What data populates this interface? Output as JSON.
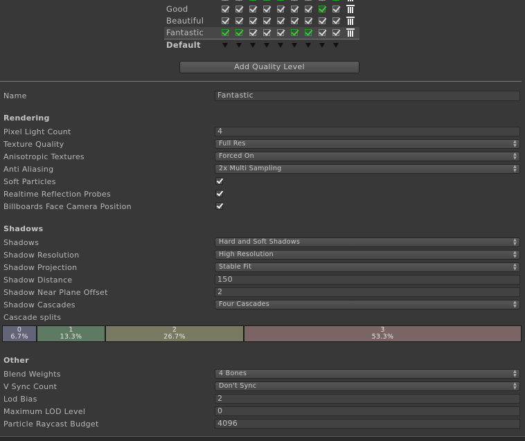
{
  "quality_levels": {
    "rows": [
      {
        "name": "",
        "checks": [
          false,
          false,
          true,
          true,
          true,
          false,
          false,
          false,
          true
        ],
        "partial": true
      },
      {
        "name": "Good",
        "checks": [
          false,
          false,
          false,
          false,
          false,
          false,
          false,
          true,
          false
        ]
      },
      {
        "name": "Beautiful",
        "checks": [
          false,
          false,
          false,
          false,
          false,
          false,
          false,
          false,
          false
        ]
      },
      {
        "name": "Fantastic",
        "checks": [
          true,
          true,
          false,
          false,
          false,
          true,
          true,
          false,
          false
        ],
        "selected": true
      }
    ],
    "default_label": "Default",
    "add_button": "Add Quality Level"
  },
  "name": {
    "label": "Name",
    "value": "Fantastic"
  },
  "rendering": {
    "header": "Rendering",
    "pixel_light_count": {
      "label": "Pixel Light Count",
      "value": "4"
    },
    "texture_quality": {
      "label": "Texture Quality",
      "value": "Full Res"
    },
    "anisotropic_textures": {
      "label": "Anisotropic Textures",
      "value": "Forced On"
    },
    "anti_aliasing": {
      "label": "Anti Aliasing",
      "value": "2x Multi Sampling"
    },
    "soft_particles": {
      "label": "Soft Particles",
      "checked": true
    },
    "realtime_reflection_probes": {
      "label": "Realtime Reflection Probes",
      "checked": true
    },
    "billboards_face_camera": {
      "label": "Billboards Face Camera Position",
      "checked": true
    }
  },
  "shadows": {
    "header": "Shadows",
    "shadows": {
      "label": "Shadows",
      "value": "Hard and Soft Shadows"
    },
    "shadow_resolution": {
      "label": "Shadow Resolution",
      "value": "High Resolution"
    },
    "shadow_projection": {
      "label": "Shadow Projection",
      "value": "Stable Fit"
    },
    "shadow_distance": {
      "label": "Shadow Distance",
      "value": "150"
    },
    "shadow_near_plane_offset": {
      "label": "Shadow Near Plane Offset",
      "value": "2"
    },
    "shadow_cascades": {
      "label": "Shadow Cascades",
      "value": "Four Cascades"
    },
    "cascade_splits": {
      "label": "Cascade splits",
      "segments": [
        {
          "index": "0",
          "percent": "6.7%",
          "fraction": 0.067,
          "color": "#626478"
        },
        {
          "index": "1",
          "percent": "13.3%",
          "fraction": 0.133,
          "color": "#5f7a62"
        },
        {
          "index": "2",
          "percent": "26.7%",
          "fraction": 0.267,
          "color": "#7a7a62"
        },
        {
          "index": "3",
          "percent": "53.3%",
          "fraction": 0.533,
          "color": "#7a6464"
        }
      ]
    }
  },
  "other": {
    "header": "Other",
    "blend_weights": {
      "label": "Blend Weights",
      "value": "4 Bones"
    },
    "v_sync_count": {
      "label": "V Sync Count",
      "value": "Don't Sync"
    },
    "lod_bias": {
      "label": "Lod Bias",
      "value": "2"
    },
    "maximum_lod_level": {
      "label": "Maximum LOD Level",
      "value": "0"
    },
    "particle_raycast_budget": {
      "label": "Particle Raycast Budget",
      "value": "4096"
    }
  }
}
